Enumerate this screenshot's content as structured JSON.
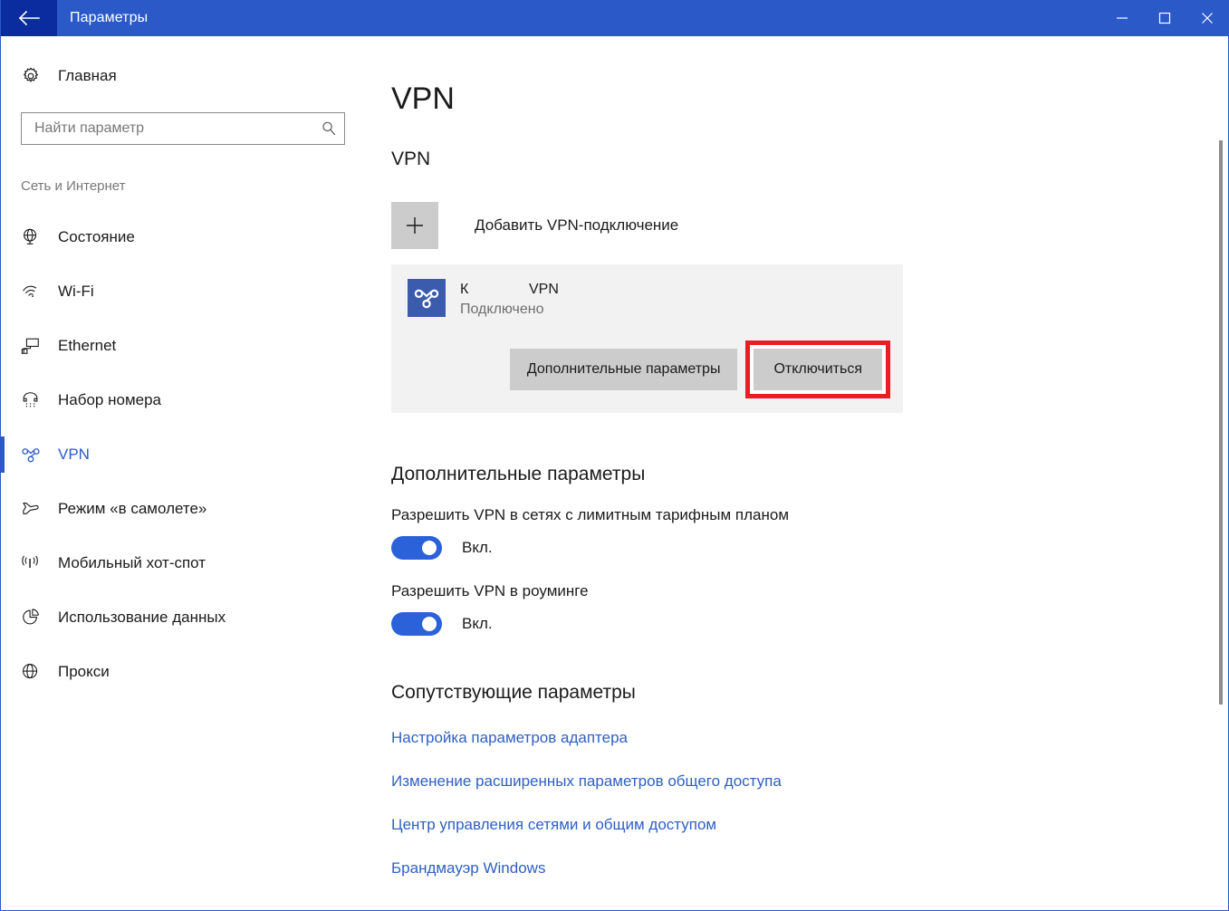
{
  "window": {
    "title": "Параметры",
    "back_icon": "back-arrow-icon",
    "controls": {
      "minimize": "—",
      "maximize": "□",
      "close": "✕"
    },
    "accent_color": "#2b59c8",
    "back_button_color": "#0a2c9e"
  },
  "sidebar": {
    "home": {
      "label": "Главная",
      "icon": "gear-icon"
    },
    "search": {
      "placeholder": "Найти параметр",
      "value": "",
      "icon": "search-icon"
    },
    "section_label": "Сеть и Интернет",
    "items": [
      {
        "label": "Состояние",
        "icon": "globe-status-icon",
        "selected": false
      },
      {
        "label": "Wi-Fi",
        "icon": "wifi-icon",
        "selected": false
      },
      {
        "label": "Ethernet",
        "icon": "ethernet-icon",
        "selected": false
      },
      {
        "label": "Набор номера",
        "icon": "dialup-phone-icon",
        "selected": false
      },
      {
        "label": "VPN",
        "icon": "vpn-knot-icon",
        "selected": true
      },
      {
        "label": "Режим «в самолете»",
        "icon": "airplane-icon",
        "selected": false
      },
      {
        "label": "Мобильный хот-спот",
        "icon": "hotspot-icon",
        "selected": false
      },
      {
        "label": "Использование данных",
        "icon": "pie-chart-icon",
        "selected": false
      },
      {
        "label": "Прокси",
        "icon": "globe-icon",
        "selected": false
      }
    ]
  },
  "main": {
    "page_title": "VPN",
    "vpn_group": {
      "heading": "VPN",
      "add_connection": {
        "label": "Добавить VPN-подключение",
        "icon": "plus-icon"
      },
      "connection": {
        "name": "К               VPN",
        "status": "Подключено",
        "icon": "vpn-knot-tile-icon",
        "tile_color": "#3b5cad",
        "buttons": {
          "advanced": "Дополнительные параметры",
          "disconnect": "Отключиться"
        },
        "highlight_color": "#ec1c24",
        "highlighted_button": "Отключиться"
      }
    },
    "advanced": {
      "heading": "Дополнительные параметры",
      "settings": [
        {
          "label": "Разрешить VPN в сетях с лимитным тарифным планом",
          "state": "Вкл.",
          "on": true
        },
        {
          "label": "Разрешить VPN в роуминге",
          "state": "Вкл.",
          "on": true
        }
      ],
      "toggle_on_color": "#2b62d9"
    },
    "related": {
      "heading": "Сопутствующие параметры",
      "links": [
        "Настройка параметров адаптера",
        "Изменение расширенных параметров общего доступа",
        "Центр управления сетями и общим доступом",
        "Брандмауэр Windows"
      ],
      "link_color": "#2f5fc4"
    }
  },
  "scrollbar": {
    "present": true
  }
}
